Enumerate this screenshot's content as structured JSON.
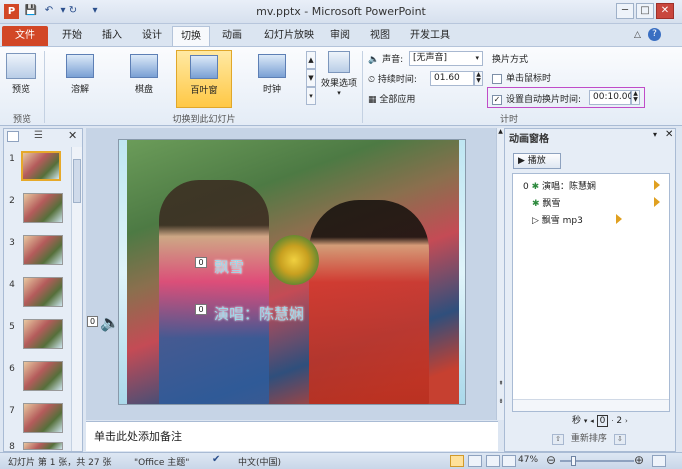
{
  "window": {
    "title": "mv.pptx - Microsoft PowerPoint",
    "app_icon_letter": "P",
    "minimize": "─",
    "maximize": "□",
    "close": "✕"
  },
  "ribbon_tabs": [
    {
      "label": "文件"
    },
    {
      "label": "开始"
    },
    {
      "label": "插入"
    },
    {
      "label": "设计"
    },
    {
      "label": "切换"
    },
    {
      "label": "动画"
    },
    {
      "label": "幻灯片放映"
    },
    {
      "label": "审阅"
    },
    {
      "label": "视图"
    },
    {
      "label": "开发工具"
    }
  ],
  "ribbon": {
    "preview": {
      "button": "预览",
      "group": "预览"
    },
    "transitions_group": {
      "label": "切换到此幻灯片",
      "items": [
        {
          "label": "溶解"
        },
        {
          "label": "棋盘"
        },
        {
          "label": "百叶窗"
        },
        {
          "label": "时钟"
        }
      ],
      "effect_options": "效果选项"
    },
    "timing": {
      "sound_label": "声音:",
      "sound_value": "[无声音]",
      "duration_label": "持续时间:",
      "duration_value": "01.60",
      "apply_all": "全部应用",
      "advance_header": "换片方式",
      "on_click": "单击鼠标时",
      "auto_after": "设置自动换片时间:",
      "auto_after_value": "00:10.00",
      "group": "计时"
    }
  },
  "slides_panel": {
    "thumbnails": [
      "1",
      "2",
      "3",
      "4",
      "5",
      "6",
      "7",
      "8"
    ]
  },
  "slide": {
    "marker_1": "0",
    "marker_2": "0",
    "marker_3": "0",
    "title_text": "飘雪",
    "subtitle_text": "演唱：陈慧娴"
  },
  "notes": {
    "placeholder": "单击此处添加备注"
  },
  "animation_pane": {
    "title": "动画窗格",
    "play": "播放",
    "items": [
      {
        "index": "0",
        "label": "演唱：陈慧娴"
      },
      {
        "index": "",
        "label": "飘雪"
      },
      {
        "index": "",
        "label": "飘雪 mp3"
      }
    ],
    "seconds_label": "秒",
    "timeline_start": "0",
    "timeline_end": "2",
    "reorder": "重新排序"
  },
  "status": {
    "slide_info": "幻灯片 第 1 张，共 27 张",
    "theme": "\"Office 主题\"",
    "language": "中文(中国)",
    "zoom": "47%"
  }
}
